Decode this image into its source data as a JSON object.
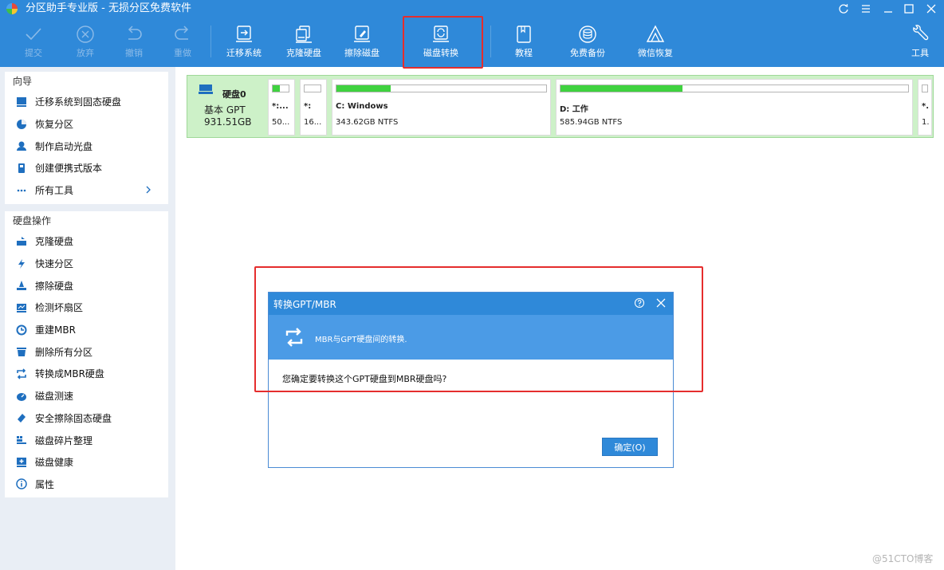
{
  "window": {
    "title": "分区助手专业版 - 无损分区免费软件"
  },
  "toolbar": {
    "items": [
      {
        "label": "提交",
        "icon": "check-icon"
      },
      {
        "label": "放弃",
        "icon": "x-circle-icon"
      },
      {
        "label": "撤销",
        "icon": "undo-icon"
      },
      {
        "label": "重做",
        "icon": "redo-icon"
      },
      {
        "label": "迁移系统",
        "icon": "migrate-os-icon"
      },
      {
        "label": "克隆硬盘",
        "icon": "clone-disk-icon"
      },
      {
        "label": "擦除磁盘",
        "icon": "wipe-disk-icon"
      },
      {
        "label": "磁盘转换",
        "icon": "disk-convert-icon"
      },
      {
        "label": "教程",
        "icon": "book-icon"
      },
      {
        "label": "免费备份",
        "icon": "backup-icon"
      },
      {
        "label": "微信恢复",
        "icon": "wechat-recovery-icon"
      },
      {
        "label": "工具",
        "icon": "tools-icon"
      }
    ]
  },
  "sidebar": {
    "wizard": {
      "title": "向导",
      "items": [
        {
          "label": "迁移系统到固态硬盘",
          "icon": "migrate-ssd-icon"
        },
        {
          "label": "恢复分区",
          "icon": "recover-partition-icon"
        },
        {
          "label": "制作启动光盘",
          "icon": "boot-disc-icon"
        },
        {
          "label": "创建便携式版本",
          "icon": "portable-icon"
        },
        {
          "label": "所有工具",
          "icon": "more-icon"
        }
      ]
    },
    "disk_ops": {
      "title": "硬盘操作",
      "items": [
        {
          "label": "克隆硬盘",
          "icon": "clone-icon"
        },
        {
          "label": "快速分区",
          "icon": "lightning-icon"
        },
        {
          "label": "擦除硬盘",
          "icon": "eraser-icon"
        },
        {
          "label": "检测坏扇区",
          "icon": "bad-sector-icon"
        },
        {
          "label": "重建MBR",
          "icon": "rebuild-icon"
        },
        {
          "label": "删除所有分区",
          "icon": "trash-icon"
        },
        {
          "label": "转换成MBR硬盘",
          "icon": "convert-icon"
        },
        {
          "label": "磁盘测速",
          "icon": "speed-icon"
        },
        {
          "label": "安全擦除固态硬盘",
          "icon": "secure-erase-icon"
        },
        {
          "label": "磁盘碎片整理",
          "icon": "defrag-icon"
        },
        {
          "label": "磁盘健康",
          "icon": "health-icon"
        },
        {
          "label": "属性",
          "icon": "info-icon"
        }
      ]
    }
  },
  "disk": {
    "name": "硬盘0",
    "type": "基本 GPT",
    "size": "931.51GB",
    "partitions": [
      {
        "name": "*:...",
        "size": "50...",
        "used": 0.45
      },
      {
        "name": "*:",
        "size": "16...",
        "used": 0.0
      },
      {
        "name": "C: Windows",
        "size": "343.62GB NTFS",
        "used": 0.26
      },
      {
        "name": "D: 工作",
        "size": "585.94GB NTFS",
        "used": 0.35
      },
      {
        "name": "*.",
        "size": "1.",
        "used": 0.0
      }
    ]
  },
  "dialog": {
    "title": "转换GPT/MBR",
    "banner": "MBR与GPT硬盘间的转换.",
    "message": "您确定要转换这个GPT硬盘到MBR硬盘吗?",
    "ok": "确定(O)"
  },
  "watermark": "@51CTO博客",
  "colors": {
    "accent": "#2f89d9",
    "disk_bg": "#cdf1c8",
    "used_fill": "#3fd23f",
    "highlight": "#e52d2d"
  }
}
